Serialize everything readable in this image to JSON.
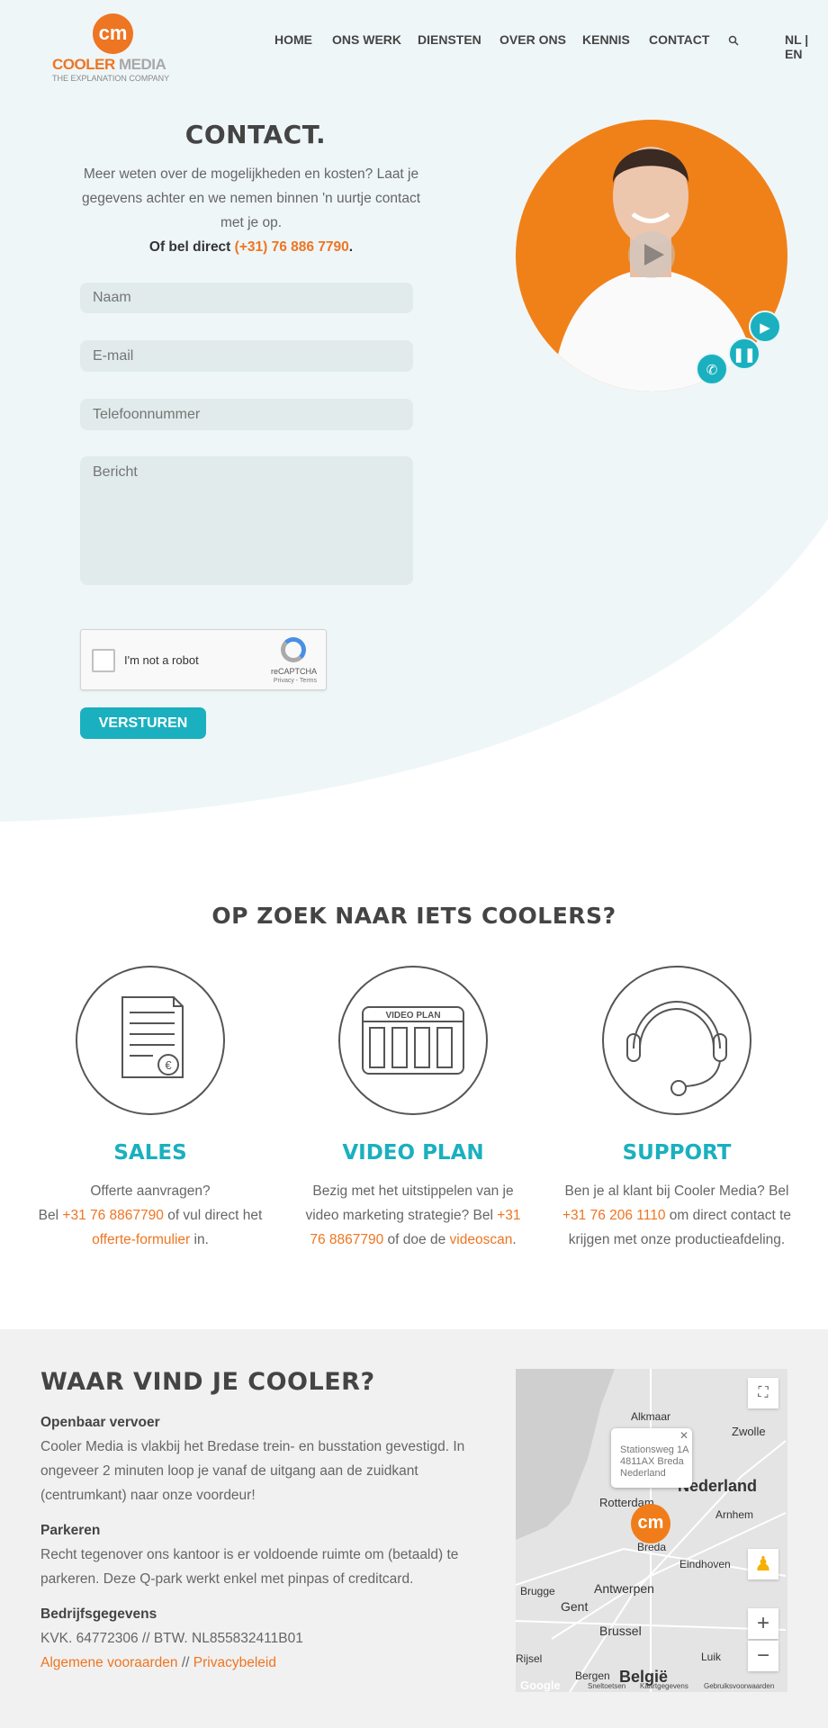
{
  "header": {
    "logo_mark": "cm",
    "logo_name_1": "COOLER",
    "logo_name_2": "MEDIA",
    "tagline": "THE EXPLANATION COMPANY",
    "nav": [
      "HOME",
      "ONS WERK",
      "DIENSTEN",
      "OVER ONS",
      "KENNIS",
      "CONTACT"
    ],
    "search_icon": "search-icon",
    "language": "NL | EN"
  },
  "contact": {
    "title": "CONTACT.",
    "intro": "Meer weten over de mogelijkheden en kosten? Laat je gegevens achter en we nemen binnen 'n uurtje contact met je op.",
    "call_prefix": "Of bel direct",
    "phone": "(+31) 76 886 7790",
    "call_suffix": ".",
    "fields": {
      "name": "Naam",
      "email": "E-mail",
      "phone": "Telefoonnummer",
      "message": "Bericht"
    },
    "captcha": {
      "label": "I'm not a robot",
      "brand": "reCAPTCHA",
      "terms": "Privacy - Terms"
    },
    "submit": "VERSTUREN"
  },
  "colors": {
    "accent_orange": "#ee7522",
    "accent_teal": "#1ab0bf",
    "hero_bg": "#eff6f8",
    "footer_bg": "#f1f1f1"
  },
  "services": {
    "title": "OP ZOEK NAAR IETS COOLERS?",
    "sales": {
      "title": "SALES",
      "l1": "Offerte aanvragen?",
      "bel": "Bel ",
      "phone": "+31 76 8867790",
      "mid": " of vul direct het ",
      "link": "offerte-formulier",
      "end": " in."
    },
    "videoplan": {
      "title": "VIDEO PLAN",
      "icon_label": "VIDEO PLAN",
      "l1": "Bezig met het uitstippelen van je video marketing strategie? Bel ",
      "phone": "+31 76 8867790",
      "mid": " of doe de ",
      "link": "videoscan",
      "end": "."
    },
    "support": {
      "title": "SUPPORT",
      "l1": "Ben je al klant bij Cooler Media? Bel ",
      "phone": "+31 76 206 1110",
      "end": "  om direct contact te krijgen met onze productieafdeling."
    }
  },
  "location": {
    "title": "WAAR VIND JE COOLER?",
    "transport_h": "Openbaar vervoer",
    "transport": "Cooler Media is vlakbij het Bredase trein- en busstation gevestigd. In ongeveer 2 minuten loop je vanaf de uitgang aan de zuidkant (centrumkant) naar onze voordeur!",
    "parking_h": "Parkeren",
    "parking": "Recht tegenover ons kantoor is er voldoende ruimte om (betaald) te parkeren. Deze Q-park werkt enkel met pinpas of creditcard.",
    "company_h": "Bedrijfsgegevens",
    "company": "KVK. 64772306 // BTW. NL855832411B01",
    "terms": "Algemene vooraarden",
    "sep": " // ",
    "privacy": "Privacybeleid"
  },
  "map": {
    "popup": {
      "l1": "Stationsweg 1A",
      "l2": "4811AX Breda",
      "l3": "Nederland"
    },
    "cities": {
      "alkmaar": "Alkmaar",
      "zwolle": "Zwolle",
      "nederland": "Nederland",
      "rotterdam": "Rotterdam",
      "arnhem": "Arnhem",
      "breda": "Breda",
      "eindhoven": "Eindhoven",
      "brugge": "Brugge",
      "antwerpen": "Antwerpen",
      "gent": "Gent",
      "brussel": "Brussel",
      "rijsel": "Rijsel",
      "luik": "Luik",
      "bergen": "Bergen",
      "belgie": "België"
    },
    "google": "Google",
    "shortcuts": "Sneltoetsen",
    "mapdata": "Kaartgegevens",
    "terms": "Gebruiksvoorwaarden"
  }
}
